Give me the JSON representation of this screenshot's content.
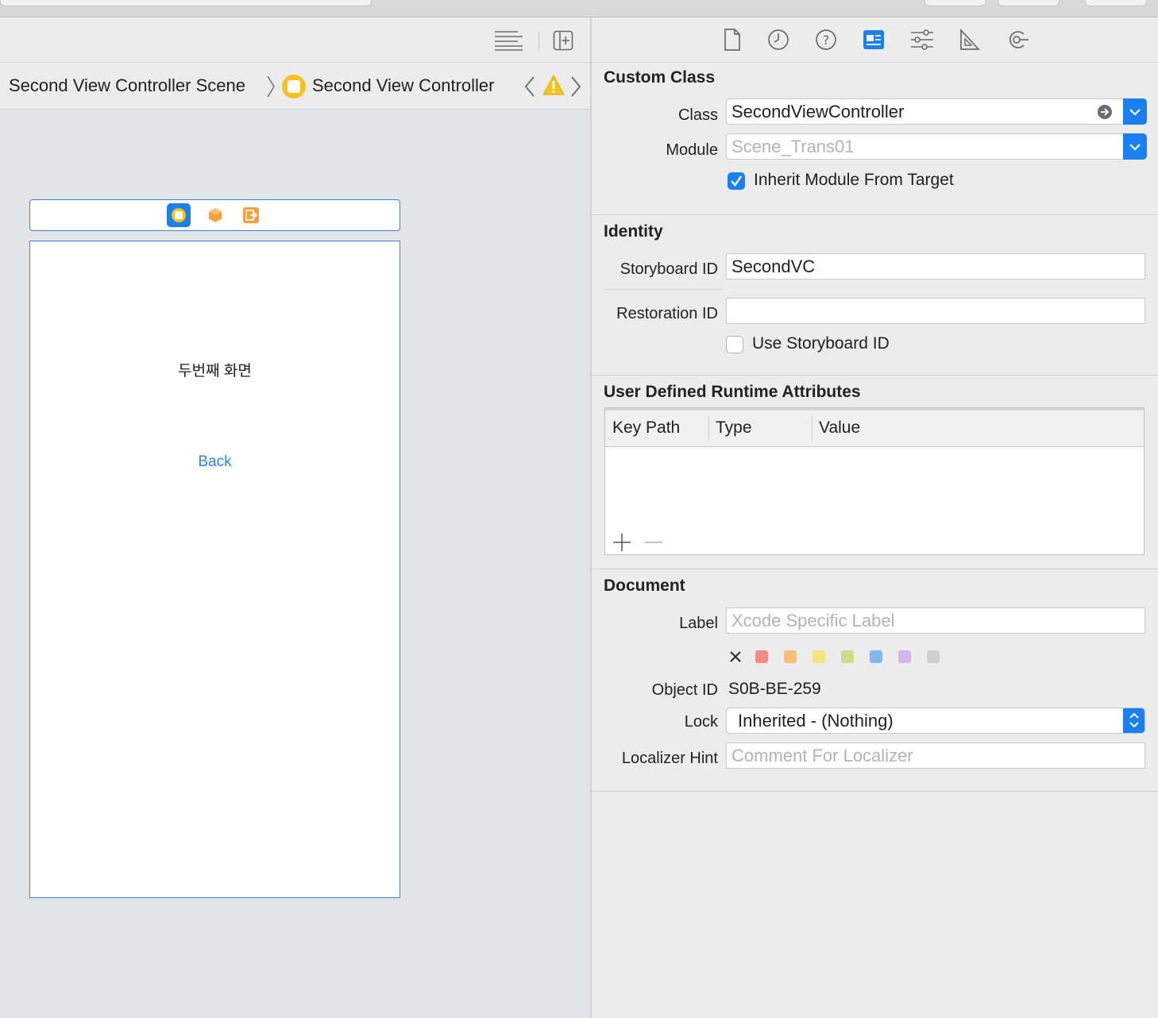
{
  "breadcrumb": {
    "scene": "Second View Controller Scene",
    "controller": "Second View Controller"
  },
  "scene": {
    "title_label": "두번째 화면",
    "back_button": "Back"
  },
  "custom_class": {
    "section_title": "Custom Class",
    "class_label": "Class",
    "class_value": "SecondViewController",
    "module_label": "Module",
    "module_placeholder": "Scene_Trans01",
    "inherit_label": "Inherit Module From Target",
    "inherit_checked": true
  },
  "identity": {
    "section_title": "Identity",
    "storyboard_id_label": "Storyboard ID",
    "storyboard_id_value": "SecondVC",
    "restoration_id_label": "Restoration ID",
    "restoration_id_value": "",
    "use_storyboard_label": "Use Storyboard ID",
    "use_storyboard_checked": false
  },
  "runtime_attributes": {
    "section_title": "User Defined Runtime Attributes",
    "columns": [
      "Key Path",
      "Type",
      "Value"
    ]
  },
  "document": {
    "section_title": "Document",
    "label_label": "Label",
    "label_placeholder": "Xcode Specific Label",
    "object_id_label": "Object ID",
    "object_id_value": "S0B-BE-259",
    "lock_label": "Lock",
    "lock_value": "Inherited - (Nothing)",
    "localizer_label": "Localizer Hint",
    "localizer_placeholder": "Comment For Localizer",
    "label_colors": [
      "#f28c82",
      "#f7c07a",
      "#f7e27c",
      "#c6e08a",
      "#7fb8ee",
      "#d9b3ec",
      "#cfcfcf"
    ]
  },
  "colors": {
    "accent": "#1a7ff1",
    "selection_blue": "#3b86e0",
    "warning": "#f5c518",
    "link": "#2b85f2"
  }
}
